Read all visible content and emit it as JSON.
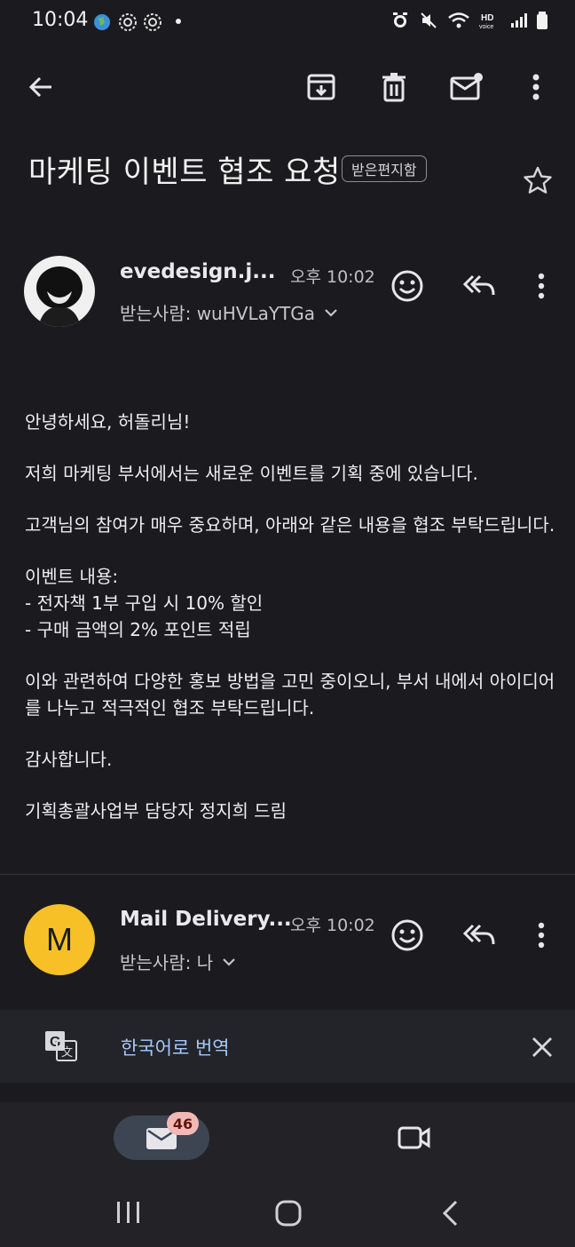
{
  "status_bar": {
    "time": "10:04"
  },
  "toolbar": {
    "back_icon": "arrow-left-icon",
    "archive_icon": "archive-icon",
    "delete_icon": "trash-icon",
    "mark_unread_icon": "mark-unread-icon",
    "more_icon": "more-vert-icon"
  },
  "email": {
    "subject": "마케팅 이벤트 협조 요청",
    "label": "받은편지함",
    "messages": [
      {
        "sender": "evedesign.j...",
        "time": "오후 10:02",
        "recipient": "받는사람: wuHVLaYTGa"
      },
      {
        "sender": "Mail Delivery...",
        "time": "오후 10:02",
        "recipient": "받는사람: 나",
        "avatar_letter": "M"
      }
    ],
    "body": {
      "greeting": "안녕하세요, 허돌리님!",
      "line1": "저희 마케팅 부서에서는 새로운 이벤트를 기획 중에 있습니다.",
      "line2": "고객님의 참여가 매우 중요하며, 아래와 같은 내용을 협조 부탁드립니다.",
      "event_heading": "이벤트 내용:",
      "event_item1": "- 전자책 1부 구입 시 10% 할인",
      "event_item2": "- 구매 금액의 2% 포인트 적립",
      "line3": "이와 관련하여 다양한 홍보 방법을 고민 중이오니, 부서 내에서 아이디어를 나누고 적극적인 협조 부탁드립니다.",
      "thanks": "감사합니다.",
      "signature": "기획총괄사업부 담당자 정지희 드림"
    }
  },
  "translate": {
    "label": "한국어로 번역"
  },
  "bottom_nav": {
    "mail_badge": "46"
  },
  "colors": {
    "background": "#1b1b1f",
    "accent_link": "#a8c7fa",
    "avatar_yellow": "#f6c026",
    "badge": "#f2b8b5"
  }
}
